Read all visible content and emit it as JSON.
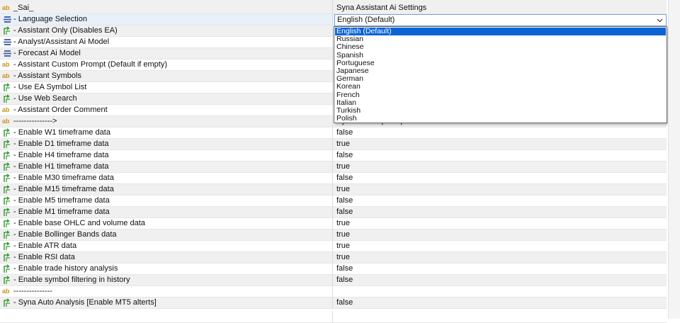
{
  "rows": [
    {
      "name": "_Sai_",
      "value": "Syna Assistant Ai Settings",
      "icon": "ab"
    },
    {
      "name": "- Language Selection",
      "value": "",
      "icon": "enum"
    },
    {
      "name": "- Assistant Only (Disables EA)",
      "value": "",
      "icon": "bool"
    },
    {
      "name": "- Analyst/Assistant Ai Model",
      "value": "",
      "icon": "enum"
    },
    {
      "name": "- Forecast Ai Model",
      "value": "",
      "icon": "enum"
    },
    {
      "name": "- Assistant Custom Prompt (Default if empty)",
      "value": "",
      "icon": "ab"
    },
    {
      "name": "- Assistant Symbols",
      "value": "",
      "icon": "ab"
    },
    {
      "name": "- Use EA Symbol List",
      "value": "",
      "icon": "bool"
    },
    {
      "name": "- Use Web Search",
      "value": "",
      "icon": "bool"
    },
    {
      "name": "- Assistant Order Comment",
      "value": "",
      "icon": "ab"
    },
    {
      "name": "--------------->",
      "value": "Syna Data Input Options",
      "icon": "ab"
    },
    {
      "name": "- Enable W1 timeframe data",
      "value": "false",
      "icon": "bool"
    },
    {
      "name": "- Enable D1 timeframe data",
      "value": "true",
      "icon": "bool"
    },
    {
      "name": "- Enable H4 timeframe data",
      "value": "false",
      "icon": "bool"
    },
    {
      "name": "- Enable H1 timeframe data",
      "value": "true",
      "icon": "bool"
    },
    {
      "name": "- Enable M30 timeframe data",
      "value": "false",
      "icon": "bool"
    },
    {
      "name": "- Enable M15 timeframe data",
      "value": "true",
      "icon": "bool"
    },
    {
      "name": "- Enable M5 timeframe data",
      "value": "false",
      "icon": "bool"
    },
    {
      "name": "- Enable M1 timeframe data",
      "value": "false",
      "icon": "bool"
    },
    {
      "name": "- Enable base OHLC and volume data",
      "value": "true",
      "icon": "bool"
    },
    {
      "name": "- Enable Bollinger Bands data",
      "value": "true",
      "icon": "bool"
    },
    {
      "name": "- Enable ATR data",
      "value": "true",
      "icon": "bool"
    },
    {
      "name": "- Enable RSI data",
      "value": "true",
      "icon": "bool"
    },
    {
      "name": "- Enable trade history analysis",
      "value": "false",
      "icon": "bool"
    },
    {
      "name": "- Enable symbol filtering in history",
      "value": "false",
      "icon": "bool"
    },
    {
      "name": "---------------",
      "value": "",
      "icon": "ab"
    },
    {
      "name": "- Syna Auto Analysis [Enable MT5 alterts]",
      "value": "false",
      "icon": "bool"
    }
  ],
  "language_combo": {
    "selected": "English (Default)",
    "options": [
      "English (Default)",
      "Russian",
      "Chinese",
      "Spanish",
      "Portuguese",
      "Japanese",
      "German",
      "Korean",
      "French",
      "Italian",
      "Turkish",
      "Polish"
    ]
  },
  "colors": {
    "selected_option": "#0a64d6",
    "ab_icon": "#c9951a",
    "bool_icon": "#3a9a3a",
    "enum_icon": "#4a6aa8"
  }
}
